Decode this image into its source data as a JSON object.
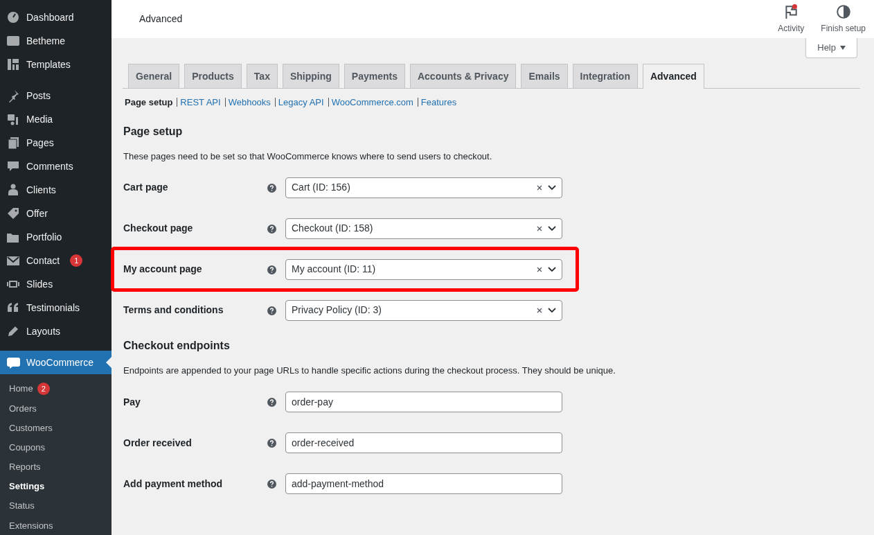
{
  "sidebar": {
    "groups": [
      [
        {
          "label": "Dashboard",
          "selected": false
        },
        {
          "label": "Betheme",
          "selected": false
        },
        {
          "label": "Templates",
          "selected": false
        }
      ],
      [
        {
          "label": "Posts",
          "selected": false
        },
        {
          "label": "Media",
          "selected": false
        },
        {
          "label": "Pages",
          "selected": false
        },
        {
          "label": "Comments",
          "selected": false
        },
        {
          "label": "Clients",
          "selected": false
        },
        {
          "label": "Offer",
          "selected": false
        },
        {
          "label": "Portfolio",
          "selected": false
        },
        {
          "label": "Contact",
          "badge": "1",
          "selected": false
        },
        {
          "label": "Slides",
          "selected": false
        },
        {
          "label": "Testimonials",
          "selected": false
        },
        {
          "label": "Layouts",
          "selected": false
        }
      ],
      [
        {
          "label": "WooCommerce",
          "selected": true,
          "children": [
            {
              "label": "Home",
              "badge": "2",
              "selected": false
            },
            {
              "label": "Orders",
              "selected": false
            },
            {
              "label": "Customers",
              "selected": false
            },
            {
              "label": "Coupons",
              "selected": false
            },
            {
              "label": "Reports",
              "selected": false
            },
            {
              "label": "Settings",
              "selected": true
            },
            {
              "label": "Status",
              "selected": false
            },
            {
              "label": "Extensions",
              "selected": false
            }
          ]
        }
      ]
    ]
  },
  "header": {
    "title": "Advanced",
    "actions": [
      {
        "label": "Activity",
        "notification": true
      },
      {
        "label": "Finish setup",
        "notification": false
      }
    ]
  },
  "help": {
    "label": "Help"
  },
  "tabs": [
    {
      "label": "General",
      "selected": false
    },
    {
      "label": "Products",
      "selected": false
    },
    {
      "label": "Tax",
      "selected": false
    },
    {
      "label": "Shipping",
      "selected": false
    },
    {
      "label": "Payments",
      "selected": false
    },
    {
      "label": "Accounts & Privacy",
      "selected": false
    },
    {
      "label": "Emails",
      "selected": false
    },
    {
      "label": "Integration",
      "selected": false
    },
    {
      "label": "Advanced",
      "selected": true
    }
  ],
  "subnav": [
    {
      "label": "Page setup",
      "selected": true
    },
    {
      "label": "REST API",
      "selected": false
    },
    {
      "label": "Webhooks",
      "selected": false
    },
    {
      "label": "Legacy API",
      "selected": false
    },
    {
      "label": "WooCommerce.com",
      "selected": false
    },
    {
      "label": "Features",
      "selected": false
    }
  ],
  "sections": [
    {
      "title": "Page setup",
      "description": "These pages need to be set so that WooCommerce knows where to send users to checkout.",
      "rows": [
        {
          "kind": "select",
          "label": "Cart page",
          "value": "Cart (ID: 156)",
          "highlighted": false
        },
        {
          "kind": "select",
          "label": "Checkout page",
          "value": "Checkout (ID: 158)",
          "highlighted": false
        },
        {
          "kind": "select",
          "label": "My account page",
          "value": "My account (ID: 11)",
          "highlighted": true
        },
        {
          "kind": "select",
          "label": "Terms and conditions",
          "value": "Privacy Policy (ID: 3)",
          "highlighted": false
        }
      ]
    },
    {
      "title": "Checkout endpoints",
      "description": "Endpoints are appended to your page URLs to handle specific actions during the checkout process. They should be unique.",
      "rows": [
        {
          "kind": "text",
          "label": "Pay",
          "value": "order-pay",
          "highlighted": false
        },
        {
          "kind": "text",
          "label": "Order received",
          "value": "order-received",
          "highlighted": false
        },
        {
          "kind": "text",
          "label": "Add payment method",
          "value": "add-payment-method",
          "highlighted": false
        }
      ]
    }
  ]
}
